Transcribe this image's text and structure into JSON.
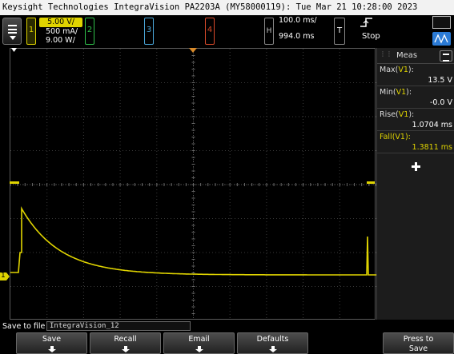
{
  "title_bar": "Keysight Technologies IntegraVision PA2203A (MY58000119): Tue Mar 21 10:28:00 2023",
  "channels": {
    "ch1": {
      "number": "1",
      "scale": "5.00 V/",
      "line2": "500 mA/",
      "line3": "9.00 W/",
      "color": "#e0d400"
    },
    "ch2": {
      "number": "2",
      "color": "#2fbf4a"
    },
    "ch3": {
      "number": "3",
      "color": "#4aa6d8"
    },
    "ch4": {
      "number": "4",
      "color": "#d84a2a"
    }
  },
  "horizontal": {
    "button_label": "H",
    "time_per_div": "100.0 ms/",
    "delay": "994.0 ms"
  },
  "trigger": {
    "button_label": "T",
    "status": "Stop"
  },
  "measurements": {
    "header": "Meas",
    "items": [
      {
        "label": "Max",
        "source": "V1",
        "value": "13.5 V",
        "highlighted": false
      },
      {
        "label": "Min",
        "source": "V1",
        "value": "-0.0 V",
        "highlighted": false
      },
      {
        "label": "Rise",
        "source": "V1",
        "value": "1.0704 ms",
        "highlighted": false
      },
      {
        "label": "Fall",
        "source": "V1",
        "value": "1.3811 ms",
        "highlighted": true
      }
    ]
  },
  "save": {
    "label": "Save to file =",
    "filename": "IntegraVision_12"
  },
  "softkeys": [
    "Save",
    "Recall",
    "Email",
    "Defaults"
  ],
  "press_to_save": {
    "line1": "Press to",
    "line2": "Save"
  },
  "markers": {
    "channel_ground": "1",
    "trigger_level": "T"
  },
  "colors": {
    "trace": "#e0d400",
    "grid": "#3a3a3a",
    "accent_blue": "#2b7bd6",
    "highlight": "#e0d400"
  }
}
